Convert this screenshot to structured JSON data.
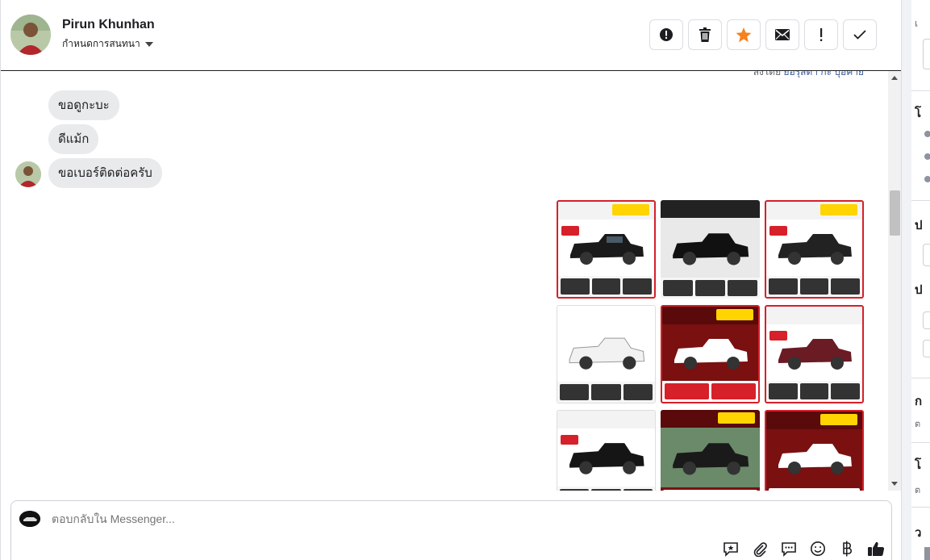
{
  "header": {
    "contact_name": "Pirun Khunhan",
    "conversation_label": "กำหนดการสนทนา"
  },
  "actions": [
    {
      "name": "spam-button",
      "icon": "alert-circle-icon"
    },
    {
      "name": "delete-button",
      "icon": "trash-icon"
    },
    {
      "name": "star-button",
      "icon": "star-icon",
      "color": "#f5821f"
    },
    {
      "name": "mark-unread-button",
      "icon": "envelope-icon"
    },
    {
      "name": "follow-up-button",
      "icon": "exclamation-icon"
    },
    {
      "name": "mark-done-button",
      "icon": "check-icon"
    }
  ],
  "messages": {
    "seen_prefix": "ลงโดย",
    "seen_link": "ยอรุสดา กะ บุอคาย",
    "items": [
      {
        "text": "ขอดูกะบะ"
      },
      {
        "text": "ดีแม้ก"
      },
      {
        "text": "ขอเบอร์ติดต่อครับ"
      }
    ]
  },
  "composer": {
    "placeholder": "ตอบกลับใน Messenger..."
  },
  "tools": [
    "saved-reply-icon",
    "attachment-icon",
    "chat-bubble-icon",
    "emoji-icon",
    "baht-icon",
    "thumbs-up-icon"
  ],
  "right_panel": {
    "chars": [
      "เ",
      "โ",
      "ป",
      "ป",
      "ก",
      "โ",
      "ว"
    ],
    "small": [
      "ต",
      "ต"
    ]
  },
  "colors": {
    "accent": "#f5821f",
    "bubble": "#e9eaec",
    "tile_border": "#d6202a"
  }
}
